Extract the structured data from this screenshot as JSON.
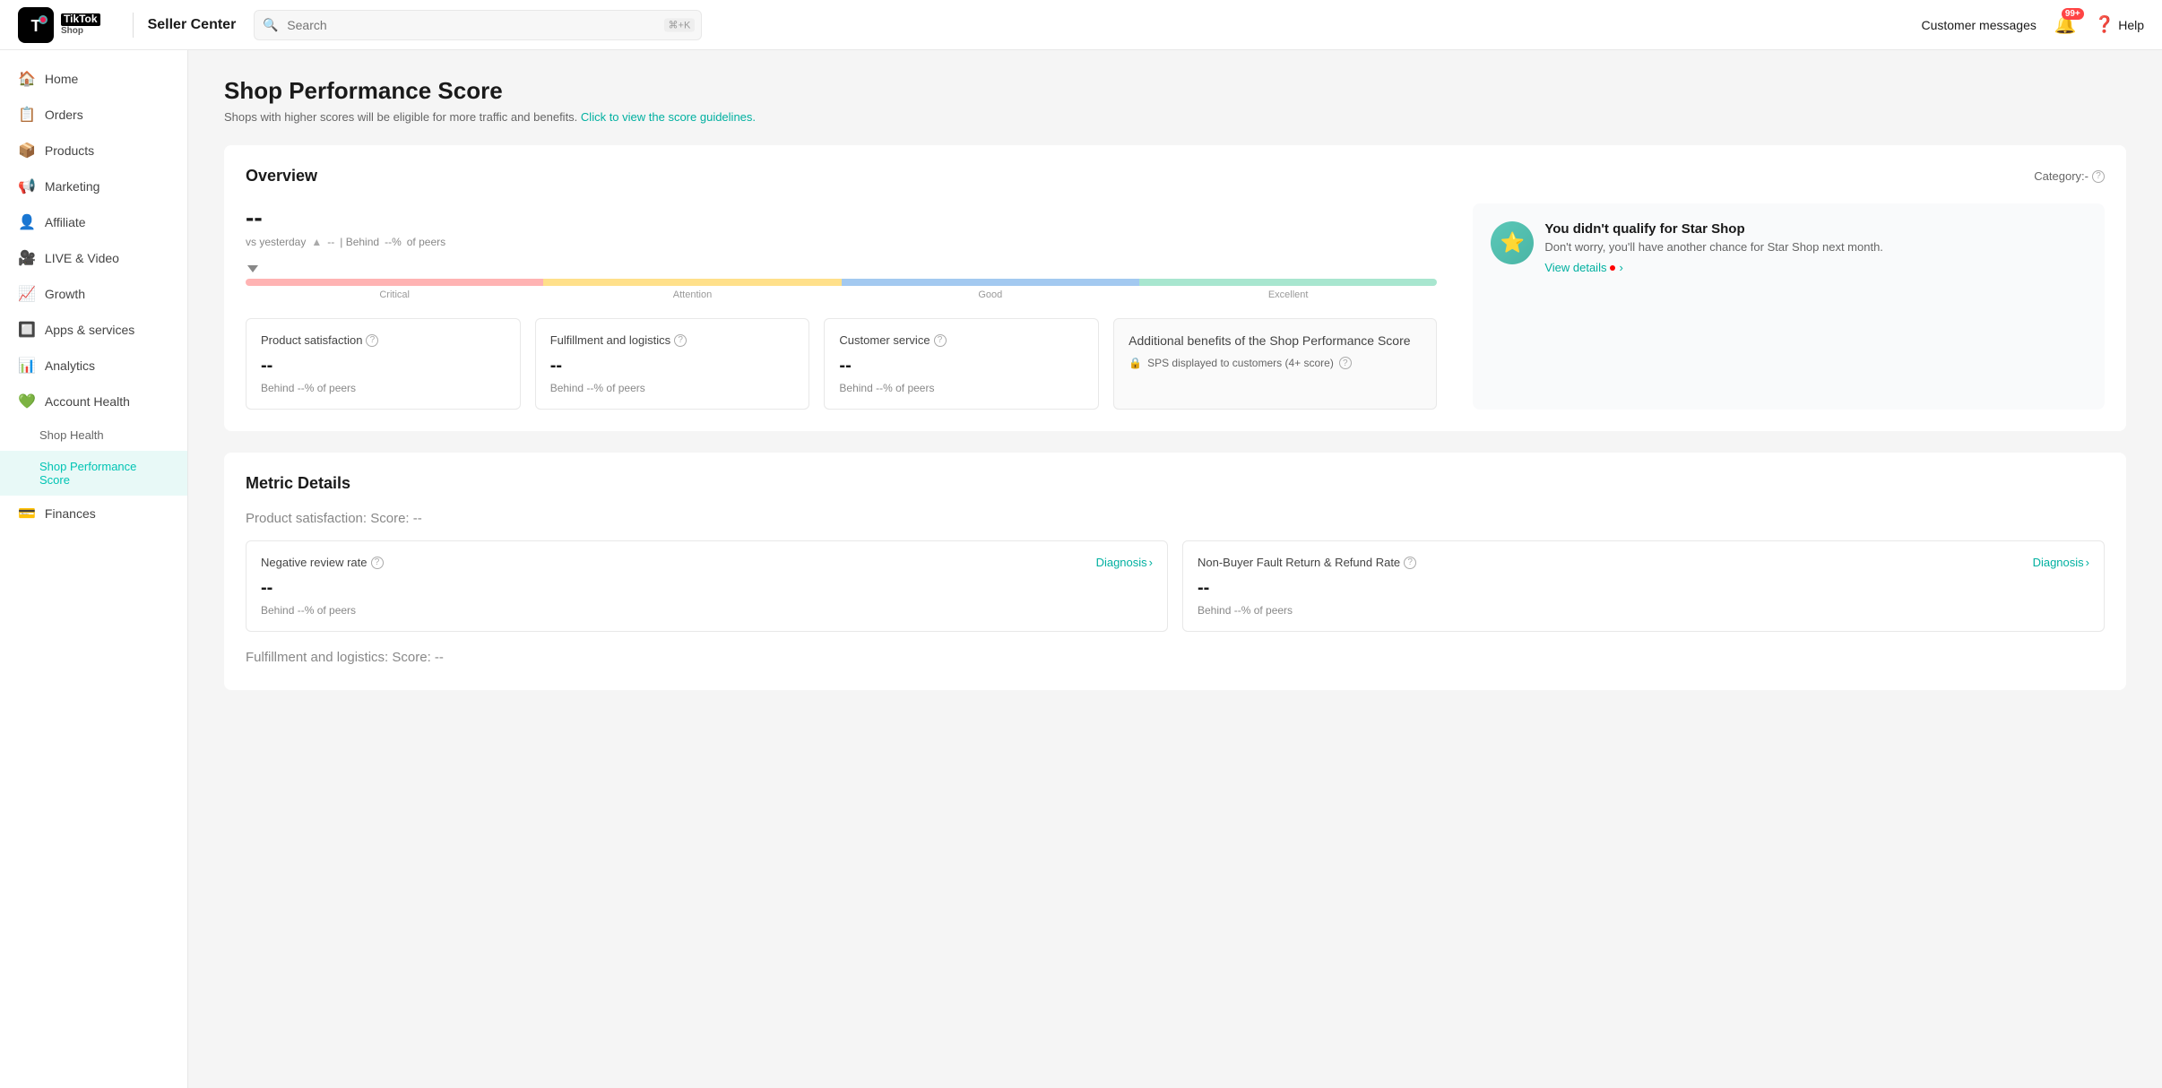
{
  "topnav": {
    "app_name": "TikTok Shop",
    "page_title": "Seller Center",
    "search_placeholder": "Search",
    "search_shortcut": "⌘+K",
    "customer_messages": "Customer messages",
    "notifications_count": "99+",
    "help_label": "Help"
  },
  "sidebar": {
    "items": [
      {
        "id": "home",
        "label": "Home",
        "icon": "🏠"
      },
      {
        "id": "orders",
        "label": "Orders",
        "icon": "📋"
      },
      {
        "id": "products",
        "label": "Products",
        "icon": "📦"
      },
      {
        "id": "marketing",
        "label": "Marketing",
        "icon": "📢"
      },
      {
        "id": "affiliate",
        "label": "Affiliate",
        "icon": "👤"
      },
      {
        "id": "live-video",
        "label": "LIVE & Video",
        "icon": "🎥"
      },
      {
        "id": "growth",
        "label": "Growth",
        "icon": "📈"
      },
      {
        "id": "apps-services",
        "label": "Apps & services",
        "icon": "🔲"
      },
      {
        "id": "analytics",
        "label": "Analytics",
        "icon": "📊"
      },
      {
        "id": "account-health",
        "label": "Account Health",
        "icon": "💚"
      },
      {
        "id": "shop-health",
        "label": "Shop Health",
        "icon": "",
        "sub": true
      },
      {
        "id": "shop-performance-score",
        "label": "Shop Performance Score",
        "icon": "",
        "sub": true,
        "active": true
      },
      {
        "id": "finances",
        "label": "Finances",
        "icon": "💳"
      }
    ]
  },
  "page": {
    "title": "Shop Performance Score",
    "subtitle": "Shops with higher scores will be eligible for more traffic and benefits.",
    "guideline_link": "Click to view the score guidelines."
  },
  "overview": {
    "title": "Overview",
    "category_label": "Category:-",
    "score_value": "--",
    "vs_yesterday": "vs yesterday",
    "trend_arrow": "▲",
    "trend_value": "--",
    "behind_label": "| Behind",
    "behind_value": "--%",
    "behind_suffix": "of peers",
    "bar_labels": [
      "Critical",
      "Attention",
      "Good",
      "Excellent"
    ],
    "metrics": [
      {
        "title": "Product satisfaction",
        "score": "--",
        "peers": "Behind --% of peers"
      },
      {
        "title": "Fulfillment and logistics",
        "score": "--",
        "peers": "Behind --% of peers"
      },
      {
        "title": "Customer service",
        "score": "--",
        "peers": "Behind --% of peers"
      }
    ],
    "benefits_title": "Additional benefits of the Shop Performance Score",
    "benefits": [
      {
        "text": "SPS displayed to customers (4+ score)"
      }
    ],
    "star_shop": {
      "title": "You didn't qualify for Star Shop",
      "desc": "Don't worry, you'll have another chance for Star Shop next month.",
      "view_details": "View details",
      "chevron": "›"
    }
  },
  "metric_details": {
    "title": "Metric Details",
    "product_satisfaction_label": "Product satisfaction:",
    "product_satisfaction_score": "Score: --",
    "diagnosis_cards": [
      {
        "title": "Negative review rate",
        "link": "Diagnosis",
        "value": "--",
        "peers": "Behind --% of peers"
      },
      {
        "title": "Non-Buyer Fault Return & Refund Rate",
        "link": "Diagnosis",
        "value": "--",
        "peers": "Behind --% of peers"
      }
    ],
    "fulfillment_label": "Fulfillment and logistics:",
    "fulfillment_score": "Score: --"
  },
  "icons": {
    "search": "🔍",
    "bell": "🔔",
    "help_circle": "❓",
    "info": "ⓘ",
    "lock": "🔒",
    "chevron_right": "›",
    "chevron_down": "▾"
  }
}
